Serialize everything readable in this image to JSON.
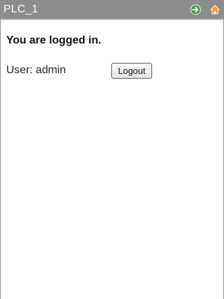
{
  "header": {
    "title": "PLC_1",
    "next_icon": "arrow-right-icon",
    "home_icon": "home-icon",
    "next_icon_color": "#2ea044",
    "home_icon_color": "#f2a11a"
  },
  "main": {
    "heading": "You are logged in.",
    "user_label": "User: admin",
    "logout_label": "Logout"
  }
}
